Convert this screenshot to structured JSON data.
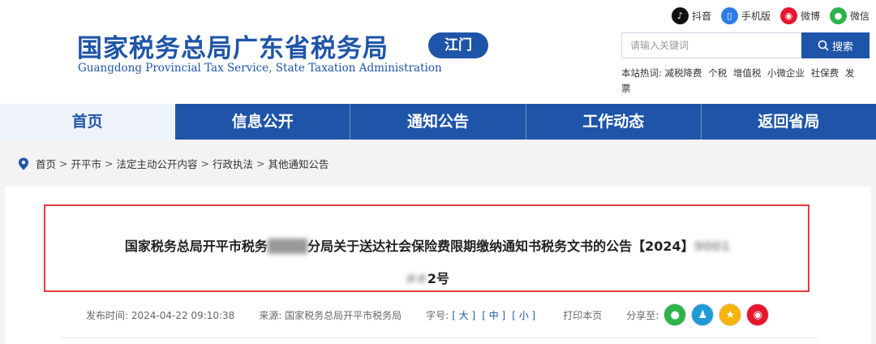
{
  "header": {
    "title": "国家税务总局广东省税务局",
    "subtitle": "Guangdong Provincial Tax Service, State Taxation Administration",
    "city_badge": "江门",
    "social": [
      {
        "label": "抖音",
        "icon": "tiktok-icon",
        "color": "#111111"
      },
      {
        "label": "手机版",
        "icon": "mobile-icon",
        "color": "#2c7be5"
      },
      {
        "label": "微博",
        "icon": "weibo-icon",
        "color": "#e6162d"
      },
      {
        "label": "微信",
        "icon": "wechat-icon",
        "color": "#2db34a"
      }
    ],
    "search": {
      "placeholder": "请输入关键词",
      "button_label": "搜索"
    },
    "hot": {
      "label": "本站热词:",
      "words": [
        "减税降费",
        "个税",
        "增值税",
        "小微企业",
        "社保费",
        "发票"
      ]
    }
  },
  "nav": {
    "items": [
      "首页",
      "信息公开",
      "通知公告",
      "工作动态",
      "返回省局"
    ],
    "active_index": 0
  },
  "breadcrumb": [
    "首页",
    "开平市",
    "法定主动公开内容",
    "行政执法",
    "其他通知公告"
  ],
  "article": {
    "title_part1": "国家税务总局开平市税务",
    "title_blur1": "████",
    "title_part2": "分局关于送达社会保险费限期缴纳通知书税务文书的公告【2024】",
    "title_blur2": "9001",
    "title_blur3": "##",
    "title_part3": "2号",
    "meta": {
      "publish_time": "发布时间: 2024-04-22 09:10:38",
      "source": "来源: 国家税务总局开平市税务局",
      "font_size_label": "字号:",
      "font_sizes": [
        "[ 大 ]",
        "[ 中 ]",
        "[ 小 ]"
      ],
      "print": "打印本页",
      "share_label": "分享至:"
    },
    "share_icons": [
      {
        "name": "wechat-share-icon",
        "color": "#2db34a"
      },
      {
        "name": "qq-share-icon",
        "color": "#1e9bd7"
      },
      {
        "name": "qzone-share-icon",
        "color": "#f5b400"
      },
      {
        "name": "weibo-share-icon",
        "color": "#e6162d"
      }
    ]
  },
  "colors": {
    "brand_blue": "#1f55a8",
    "highlight_red": "#e23a3a"
  }
}
